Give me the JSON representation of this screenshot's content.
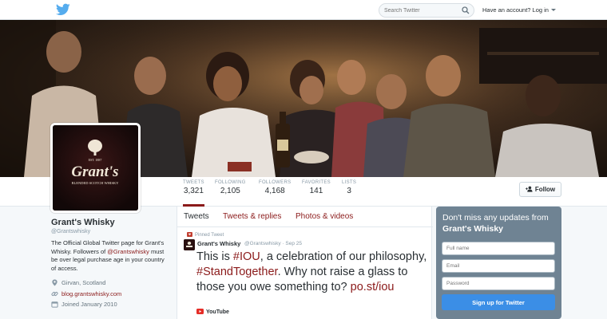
{
  "topbar": {
    "search_placeholder": "Search Twitter",
    "account_text": "Have an account? Log in"
  },
  "profile": {
    "name": "Grant's Whisky",
    "handle": "@Grantswhisky",
    "bio_before": "The Official Global Twitter page for Grant's Whisky. Followers of ",
    "bio_mention": "@Grantswhisky",
    "bio_after": " must be over legal purchase age in your country of access.",
    "location": "Girvan, Scotland",
    "website": "blog.grantswhisky.com",
    "joined": "Joined January 2010",
    "avatar": {
      "brand": "Grant's",
      "est": "EST. 1887",
      "tagline": "BLENDED SCOTCH WHISKY"
    }
  },
  "stats": [
    {
      "label": "TWEETS",
      "value": "3,321"
    },
    {
      "label": "FOLLOWING",
      "value": "2,105"
    },
    {
      "label": "FOLLOWERS",
      "value": "4,168"
    },
    {
      "label": "FAVORITES",
      "value": "141"
    },
    {
      "label": "LISTS",
      "value": "3"
    }
  ],
  "follow_button": "Follow",
  "timeline": {
    "tabs": [
      "Tweets",
      "Tweets & replies",
      "Photos & videos"
    ],
    "pinned_label": "Pinned Tweet",
    "tweet": {
      "author": "Grant's Whisky",
      "handle_time": "@Grantswhisky · Sep 25",
      "t1": "This is ",
      "h1": "#IOU",
      "t2": ", a celebration of our philosophy, ",
      "h2": "#StandTogether",
      "t3": ". Why not raise a glass to those you owe something to? ",
      "link": "po.st/iou",
      "source": "YouTube"
    }
  },
  "signup": {
    "heading_prefix": "Don't miss any updates from ",
    "heading_brand": "Grant's Whisky",
    "fullname_placeholder": "Full name",
    "email_placeholder": "Email",
    "password_placeholder": "Password",
    "button": "Sign up for Twitter"
  },
  "colors": {
    "accent": "#8b1a1a",
    "twitter_blue": "#55acee",
    "signup_bg": "#6f8393",
    "signup_button": "#3b8ee6"
  },
  "icons": [
    "twitter-bird-icon",
    "search-icon",
    "add-person-icon",
    "pin-icon",
    "location-icon",
    "link-icon",
    "calendar-icon",
    "youtube-icon"
  ]
}
